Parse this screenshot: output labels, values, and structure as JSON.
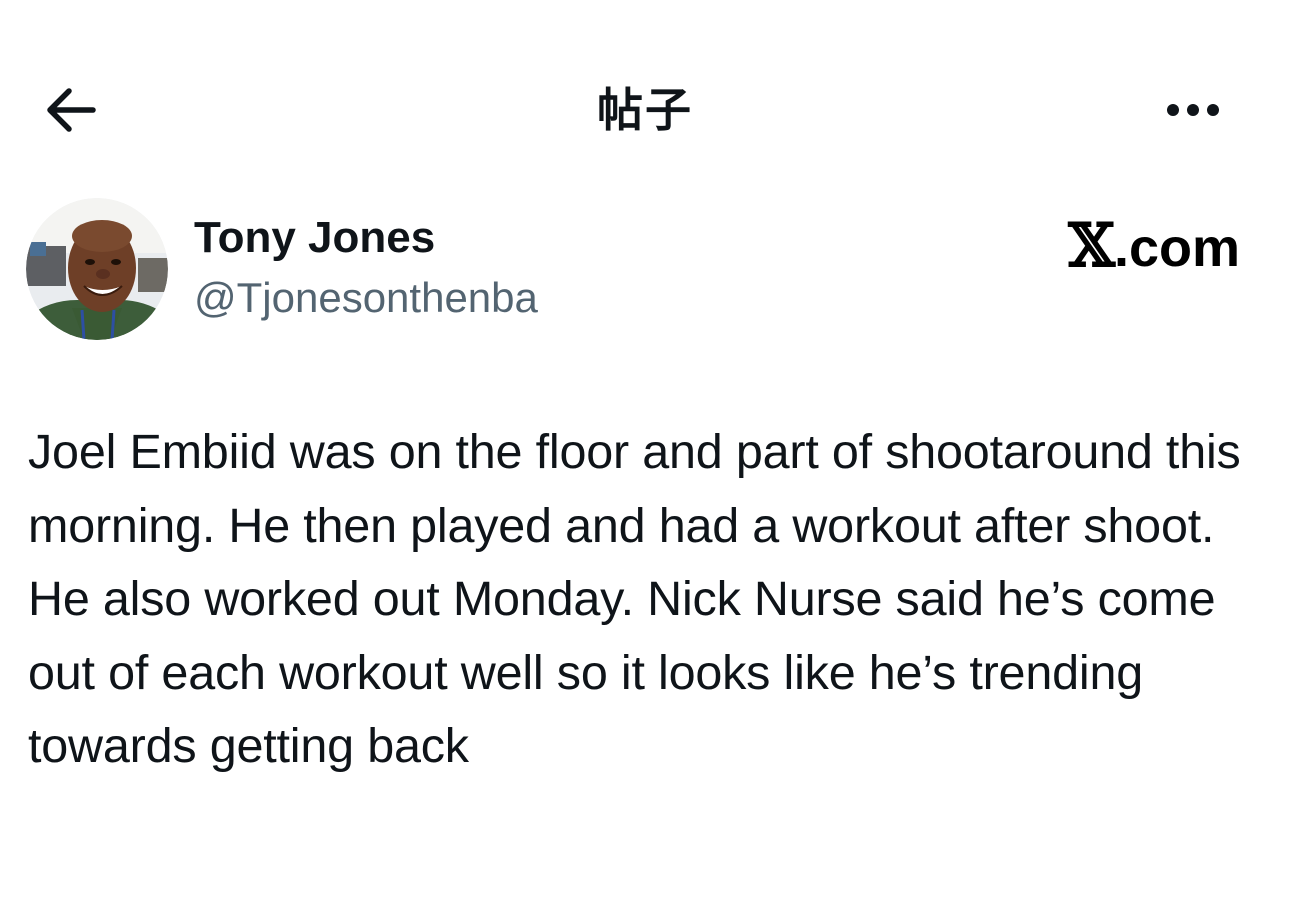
{
  "header": {
    "title": "帖子",
    "back_icon": "arrow-left-icon",
    "more_icon": "more-horizontal-icon"
  },
  "author": {
    "name": "Tony Jones",
    "handle": "@Tjonesonthenba",
    "avatar_icon": "avatar-photo"
  },
  "watermark": {
    "x_glyph": "𝕏",
    "domain": ".com"
  },
  "tweet": {
    "text": "Joel Embiid was on the floor and part of shootaround this morning. He then played and had a workout after shoot. He also worked out Monday. Nick Nurse said he’s come out of each workout well so it looks like he’s trending towards getting back"
  },
  "colors": {
    "text_primary": "#0f1419",
    "text_secondary": "#536471",
    "background": "#ffffff"
  }
}
